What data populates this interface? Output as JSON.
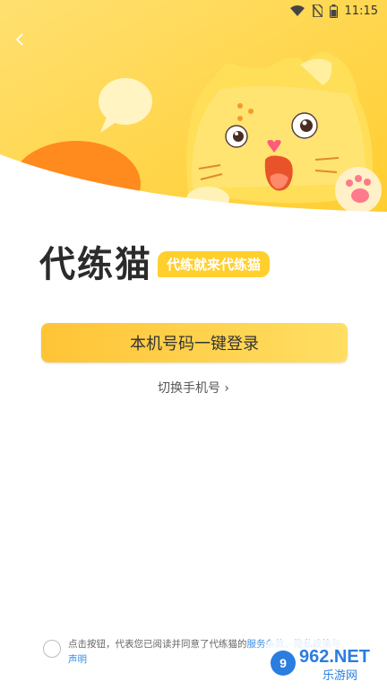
{
  "status_bar": {
    "time": "11:15"
  },
  "brand": {
    "title": "代练猫",
    "slogan": "代练就来代练猫"
  },
  "login": {
    "one_tap_label": "本机号码一键登录",
    "switch_label": "切换手机号 ›"
  },
  "agreement": {
    "prefix": "点击按钮，代表您已阅读并同意了代练猫的",
    "terms_link": "服务条款",
    "separator": "、",
    "privacy_link": "隐私政策与声明"
  },
  "watermark": {
    "brand": "962.NET",
    "sub": "乐游网"
  },
  "colors": {
    "accent": "#FFC436",
    "hero_bg": "#FFD84A",
    "link": "#3C8EE8"
  }
}
